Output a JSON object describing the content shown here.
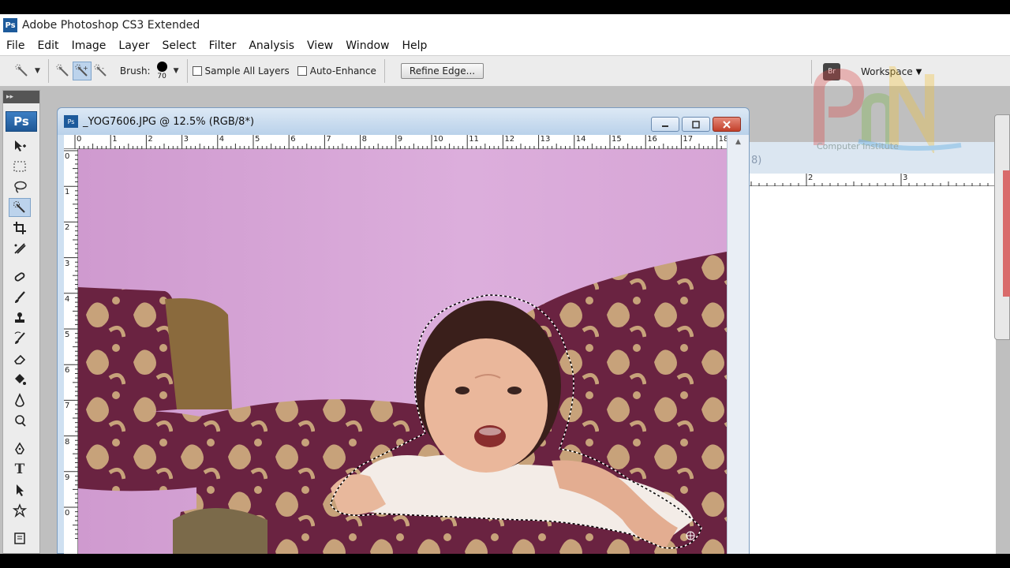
{
  "app": {
    "logo": "Ps",
    "title": "Adobe Photoshop CS3 Extended"
  },
  "menu": [
    "File",
    "Edit",
    "Image",
    "Layer",
    "Select",
    "Filter",
    "Analysis",
    "View",
    "Window",
    "Help"
  ],
  "options": {
    "brush_label": "Brush:",
    "brush_size": "70",
    "sample_all_layers": "Sample All Layers",
    "sample_all_layers_checked": false,
    "auto_enhance": "Auto-Enhance",
    "auto_enhance_checked": false,
    "refine_edge": "Refine Edge...",
    "workspace": "Workspace",
    "workspace_icon_text": "Br"
  },
  "toolbox": {
    "collapse": "▸▸",
    "logo": "Ps"
  },
  "document": {
    "icon_text": "Ps",
    "title": "_YOG7606.JPG @ 12.5% (RGB/8*)",
    "ruler_top": [
      "0",
      "1",
      "2",
      "3",
      "4",
      "5",
      "6",
      "7",
      "8",
      "9",
      "10",
      "11",
      "12",
      "13",
      "14",
      "15",
      "16",
      "17",
      "18"
    ],
    "ruler_left": [
      "0",
      "1",
      "2",
      "3",
      "4",
      "5",
      "6",
      "7",
      "8",
      "9",
      "0"
    ],
    "selection": "marching-ants outline around the child"
  },
  "document2": {
    "title_fragment": "8)",
    "ruler": [
      "2",
      "3"
    ]
  },
  "watermark": {
    "text": "Computer Institute"
  },
  "colors": {
    "wall": "#d8a6d8",
    "sofa": "#6e2443",
    "sofa_pattern": "#c9a57e",
    "selection_accent": "#ffffff",
    "ps_blue": "#1d5a9b"
  }
}
